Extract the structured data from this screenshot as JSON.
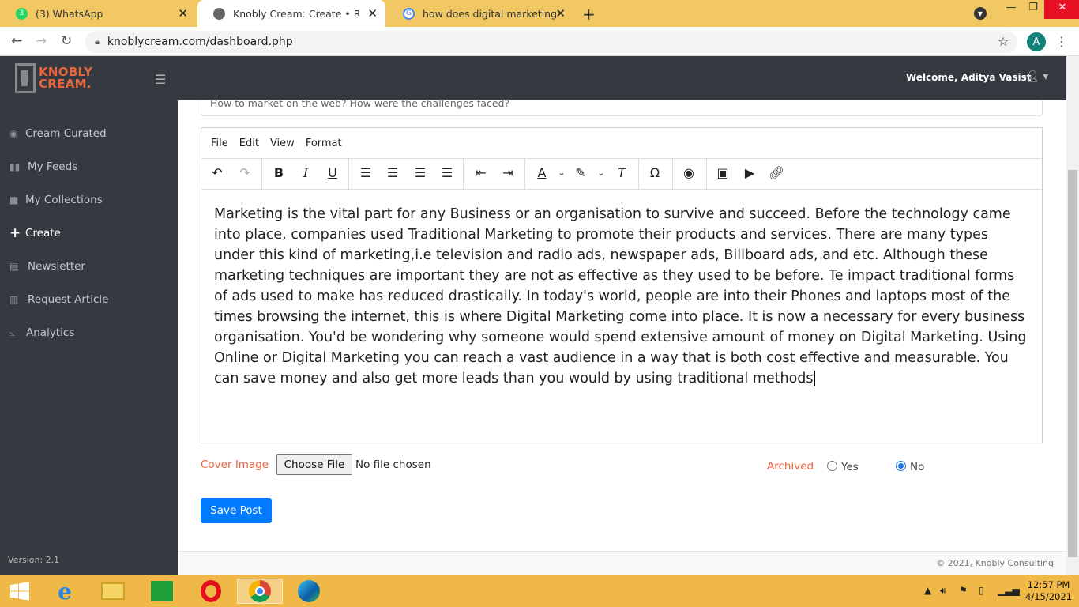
{
  "browser": {
    "tabs": [
      {
        "title": "(3) WhatsApp",
        "badge": "3"
      },
      {
        "title": "Knobly Cream: Create • Reach • M"
      },
      {
        "title": "how does digital marketing help"
      }
    ],
    "url": "knoblycream.com/dashboard.php",
    "profile_initial": "A"
  },
  "header": {
    "logo_line1": "KNOBLY",
    "logo_line2": "CREAM.",
    "welcome": "Welcome, Aditya Vasist"
  },
  "sidebar": {
    "items": [
      {
        "label": "Cream Curated",
        "icon": "rss-icon"
      },
      {
        "label": "My Feeds",
        "icon": "book-icon"
      },
      {
        "label": "My Collections",
        "icon": "save-icon"
      },
      {
        "label": "Create",
        "icon": "plus-icon"
      },
      {
        "label": "Newsletter",
        "icon": "newspaper-icon"
      },
      {
        "label": "Request Article",
        "icon": "map-icon"
      },
      {
        "label": "Analytics",
        "icon": "chart-icon"
      }
    ],
    "version": "Version: 2.1"
  },
  "form": {
    "title_value": "How to market on the web? How were the challenges faced?",
    "editor_menu": [
      "File",
      "Edit",
      "View",
      "Format"
    ],
    "body_text": "Marketing is the vital part for any Business or an organisation to survive and succeed. Before the technology came into place, companies used Traditional Marketing to promote their products and services. There are many types under this kind of marketing,i.e television and radio ads, newspaper ads, Billboard ads, and etc. Although these marketing techniques are important they are not as effective as they used to be before. Te impact traditional forms of ads used to make has reduced drastically. In today's world, people are  into their Phones and laptops most of the times browsing the internet, this is where Digital Marketing come into place. It is now a necessary for every business organisation. You'd be wondering why someone would spend extensive amount of money on Digital Marketing. Using Online or Digital Marketing you can reach a vast audience in a way that is both cost effective and measurable. You can save money and also get more leads than you would by using traditional methods",
    "cover_label": "Cover Image",
    "choose_file": "Choose File",
    "no_file": "No file chosen",
    "archived_label": "Archived",
    "yes_label": "Yes",
    "no_label": "No",
    "save_label": "Save Post"
  },
  "footer": {
    "copyright": "© 2021, Knobly Consulting"
  },
  "taskbar": {
    "time": "12:57 PM",
    "date": "4/15/2021"
  },
  "colors": {
    "accent": "#e8663d",
    "primary": "#007bff",
    "sidebar_bg": "#343a40"
  }
}
